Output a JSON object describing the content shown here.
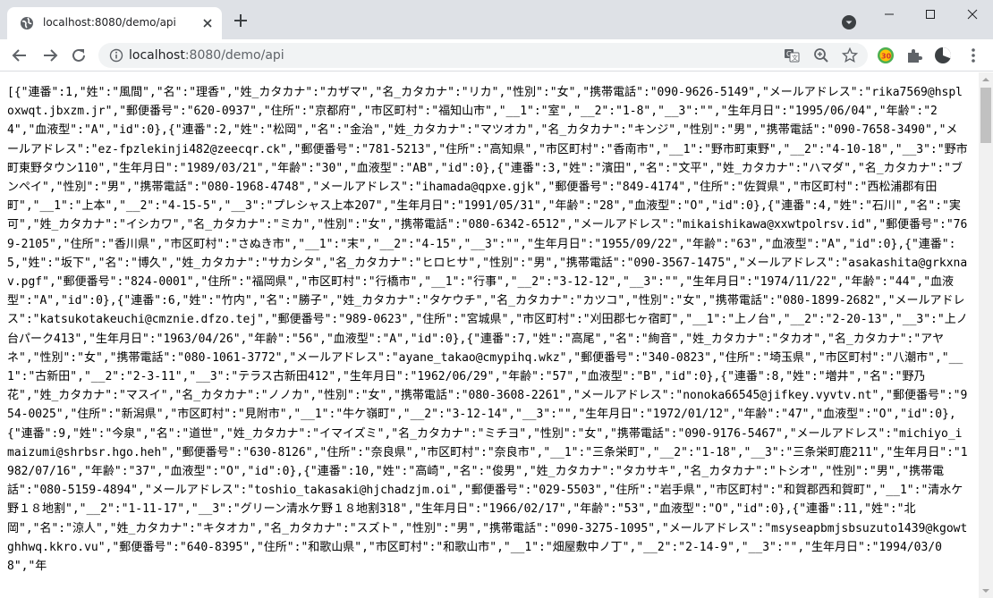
{
  "tab": {
    "title": "localhost:8080/demo/api",
    "favicon": "globe-icon",
    "close_icon": "close-icon",
    "new_tab_icon": "plus-icon"
  },
  "window": {
    "minimize_icon": "minimize-icon",
    "maximize_icon": "maximize-icon",
    "close_icon": "close-icon"
  },
  "toolbar": {
    "back_icon": "arrow-left-icon",
    "forward_icon": "arrow-right-icon",
    "reload_icon": "reload-icon",
    "url_host": "localhost",
    "url_path": ":8080/demo/api",
    "site_info_icon": "info-icon",
    "right_icons": [
      "translate-icon",
      "zoom-icon",
      "star-icon",
      "extension-badge-icon",
      "puzzle-icon",
      "profile-icon",
      "kebab-menu-icon"
    ]
  },
  "body_text": "[{\"連番\":1,\"姓\":\"風間\",\"名\":\"理香\",\"姓_カタカナ\":\"カザマ\",\"名_カタカナ\":\"リカ\",\"性別\":\"女\",\"携帯電話\":\"090-9626-5149\",\"メールアドレス\":\"rika7569@hsploxwqt.jbxzm.jr\",\"郵便番号\":\"620-0937\",\"住所\":\"京都府\",\"市区町村\":\"福知山市\",\"__1\":\"室\",\"__2\":\"1-8\",\"__3\":\"\",\"生年月日\":\"1995/06/04\",\"年齢\":\"24\",\"血液型\":\"A\",\"id\":0},{\"連番\":2,\"姓\":\"松岡\",\"名\":\"金治\",\"姓_カタカナ\":\"マツオカ\",\"名_カタカナ\":\"キンジ\",\"性別\":\"男\",\"携帯電話\":\"090-7658-3490\",\"メールアドレス\":\"ez-fpzlekinji482@zeecqr.ck\",\"郵便番号\":\"781-5213\",\"住所\":\"高知県\",\"市区町村\":\"香南市\",\"__1\":\"野市町東野\",\"__2\":\"4-10-18\",\"__3\":\"野市町東野タウン110\",\"生年月日\":\"1989/03/21\",\"年齢\":\"30\",\"血液型\":\"AB\",\"id\":0},{\"連番\":3,\"姓\":\"濱田\",\"名\":\"文平\",\"姓_カタカナ\":\"ハマダ\",\"名_カタカナ\":\"ブンペイ\",\"性別\":\"男\",\"携帯電話\":\"080-1968-4748\",\"メールアドレス\":\"ihamada@qpxe.gjk\",\"郵便番号\":\"849-4174\",\"住所\":\"佐賀県\",\"市区町村\":\"西松浦郡有田町\",\"__1\":\"上本\",\"__2\":\"4-15-5\",\"__3\":\"プレシャス上本207\",\"生年月日\":\"1991/05/31\",\"年齢\":\"28\",\"血液型\":\"O\",\"id\":0},{\"連番\":4,\"姓\":\"石川\",\"名\":\"実可\",\"姓_カタカナ\":\"イシカワ\",\"名_カタカナ\":\"ミカ\",\"性別\":\"女\",\"携帯電話\":\"080-6342-6512\",\"メールアドレス\":\"mikaishikawa@xxwtpolrsv.id\",\"郵便番号\":\"769-2105\",\"住所\":\"香川県\",\"市区町村\":\"さぬき市\",\"__1\":\"末\",\"__2\":\"4-15\",\"__3\":\"\",\"生年月日\":\"1955/09/22\",\"年齢\":\"63\",\"血液型\":\"A\",\"id\":0},{\"連番\":5,\"姓\":\"坂下\",\"名\":\"博久\",\"姓_カタカナ\":\"サカシタ\",\"名_カタカナ\":\"ヒロヒサ\",\"性別\":\"男\",\"携帯電話\":\"090-3567-1475\",\"メールアドレス\":\"asakashita@grkxnav.pgf\",\"郵便番号\":\"824-0001\",\"住所\":\"福岡県\",\"市区町村\":\"行橋市\",\"__1\":\"行事\",\"__2\":\"3-12-12\",\"__3\":\"\",\"生年月日\":\"1974/11/22\",\"年齢\":\"44\",\"血液型\":\"A\",\"id\":0},{\"連番\":6,\"姓\":\"竹内\",\"名\":\"勝子\",\"姓_カタカナ\":\"タケウチ\",\"名_カタカナ\":\"カツコ\",\"性別\":\"女\",\"携帯電話\":\"080-1899-2682\",\"メールアドレス\":\"katsukotakeuchi@cmznie.dfzo.tej\",\"郵便番号\":\"989-0623\",\"住所\":\"宮城県\",\"市区町村\":\"刈田郡七ヶ宿町\",\"__1\":\"上ノ台\",\"__2\":\"2-20-13\",\"__3\":\"上ノ台パーク413\",\"生年月日\":\"1963/04/26\",\"年齢\":\"56\",\"血液型\":\"A\",\"id\":0},{\"連番\":7,\"姓\":\"高尾\",\"名\":\"絢音\",\"姓_カタカナ\":\"タカオ\",\"名_カタカナ\":\"アヤネ\",\"性別\":\"女\",\"携帯電話\":\"080-1061-3772\",\"メールアドレス\":\"ayane_takao@cmypihq.wkz\",\"郵便番号\":\"340-0823\",\"住所\":\"埼玉県\",\"市区町村\":\"八潮市\",\"__1\":\"古新田\",\"__2\":\"2-3-11\",\"__3\":\"テラス古新田412\",\"生年月日\":\"1962/06/29\",\"年齢\":\"57\",\"血液型\":\"B\",\"id\":0},{\"連番\":8,\"姓\":\"増井\",\"名\":\"野乃花\",\"姓_カタカナ\":\"マスイ\",\"名_カタカナ\":\"ノノカ\",\"性別\":\"女\",\"携帯電話\":\"080-3608-2261\",\"メールアドレス\":\"nonoka66545@jifkey.vyvtv.nt\",\"郵便番号\":\"954-0025\",\"住所\":\"新潟県\",\"市区町村\":\"見附市\",\"__1\":\"牛ケ嶺町\",\"__2\":\"3-12-14\",\"__3\":\"\",\"生年月日\":\"1972/01/12\",\"年齢\":\"47\",\"血液型\":\"O\",\"id\":0},{\"連番\":9,\"姓\":\"今泉\",\"名\":\"道世\",\"姓_カタカナ\":\"イマイズミ\",\"名_カタカナ\":\"ミチヨ\",\"性別\":\"女\",\"携帯電話\":\"090-9176-5467\",\"メールアドレス\":\"michiyo_imaizumi@shrbsr.hgo.heh\",\"郵便番号\":\"630-8126\",\"住所\":\"奈良県\",\"市区町村\":\"奈良市\",\"__1\":\"三条栄町\",\"__2\":\"1-18\",\"__3\":\"三条栄町鹿211\",\"生年月日\":\"1982/07/16\",\"年齢\":\"37\",\"血液型\":\"O\",\"id\":0},{\"連番\":10,\"姓\":\"高崎\",\"名\":\"俊男\",\"姓_カタカナ\":\"タカサキ\",\"名_カタカナ\":\"トシオ\",\"性別\":\"男\",\"携帯電話\":\"080-5159-4894\",\"メールアドレス\":\"toshio_takasaki@hjchadzjm.oi\",\"郵便番号\":\"029-5503\",\"住所\":\"岩手県\",\"市区町村\":\"和賀郡西和賀町\",\"__1\":\"清水ケ野１８地割\",\"__2\":\"1-11-17\",\"__3\":\"グリーン清水ケ野１８地割318\",\"生年月日\":\"1966/02/17\",\"年齢\":\"53\",\"血液型\":\"O\",\"id\":0},{\"連番\":11,\"姓\":\"北岡\",\"名\":\"涼人\",\"姓_カタカナ\":\"キタオカ\",\"名_カタカナ\":\"スズト\",\"性別\":\"男\",\"携帯電話\":\"090-3275-1095\",\"メールアドレス\":\"msyseapbmjsbsuzuto1439@kgowtghhwq.kkro.vu\",\"郵便番号\":\"640-8395\",\"住所\":\"和歌山県\",\"市区町村\":\"和歌山市\",\"__1\":\"畑屋敷中ノ丁\",\"__2\":\"2-14-9\",\"__3\":\"\",\"生年月日\":\"1994/03/08\",\"年"
}
